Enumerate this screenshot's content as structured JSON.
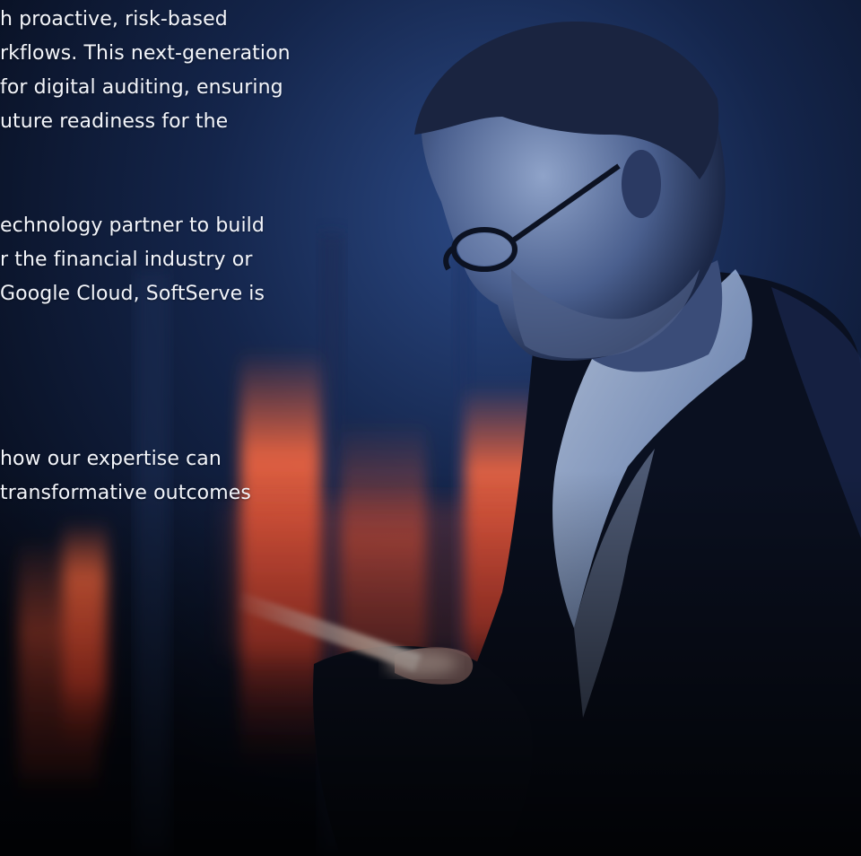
{
  "article": {
    "paragraph_1": [
      "h proactive, risk-based",
      "rkflows. This next-generation",
      " for digital auditing, ensuring",
      "uture readiness for the"
    ],
    "paragraph_2": [
      "echnology partner to build",
      "r the financial industry or",
      "Google Cloud, SoftServe is"
    ],
    "paragraph_3": [
      "how our expertise can",
      "transformative outcomes"
    ]
  },
  "hero_image": {
    "icon": "man-with-phone-photo",
    "colors": {
      "background": "#070d1c",
      "blue_glow": "#3b5a9a",
      "orange_glow": "#ff5a3a",
      "text": "#f3f5fa"
    }
  }
}
